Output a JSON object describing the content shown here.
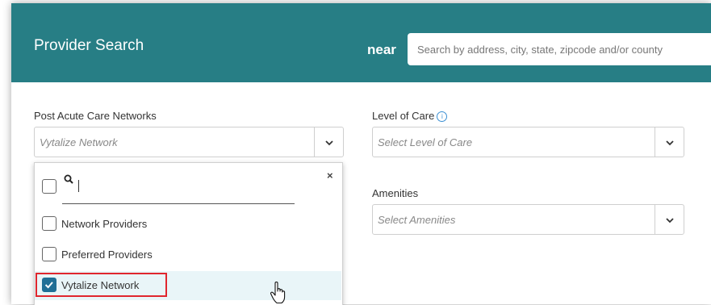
{
  "header": {
    "title": "Provider Search",
    "near_label": "near",
    "search_placeholder": "Search by address, city, state, zipcode and/or county"
  },
  "filters": {
    "networks": {
      "label": "Post Acute Care Networks",
      "value": "Vytalize Network"
    },
    "level_of_care": {
      "label": "Level of Care",
      "placeholder": "Select Level of Care"
    },
    "amenities": {
      "label": "Amenities",
      "placeholder": "Select Amenities"
    }
  },
  "dropdown": {
    "search_value": "",
    "close_glyph": "×",
    "options": [
      {
        "label": "Network Providers",
        "checked": false
      },
      {
        "label": "Preferred Providers",
        "checked": false
      },
      {
        "label": "Vytalize Network",
        "checked": true
      }
    ]
  },
  "colors": {
    "header_bg": "#277e85",
    "checked": "#1f6f96",
    "highlight": "#e0262e"
  }
}
